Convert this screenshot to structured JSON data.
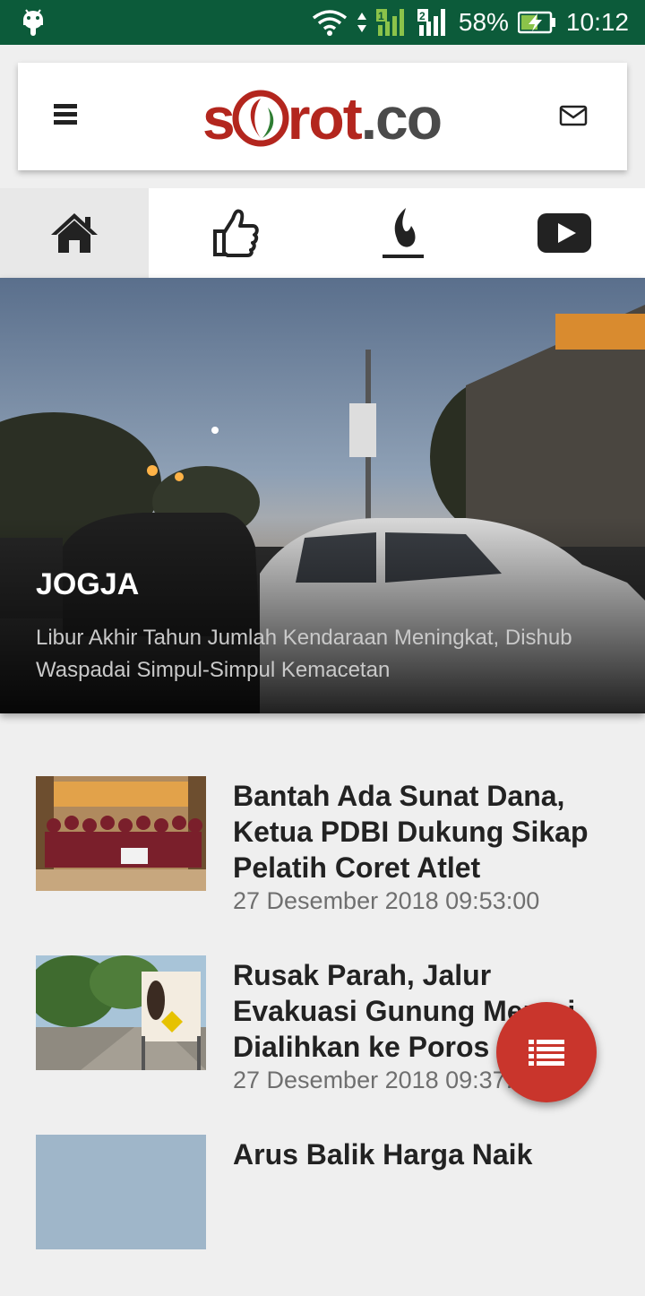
{
  "status_bar": {
    "battery": "58%",
    "time": "10:12",
    "sim1": "1",
    "sim2": "2"
  },
  "header": {
    "logo_left": "s",
    "logo_right": "rot",
    "logo_suffix": ".co"
  },
  "tabs": [
    {
      "name": "home",
      "icon": "home-icon"
    },
    {
      "name": "popular",
      "icon": "thumbs-up-icon"
    },
    {
      "name": "trending",
      "icon": "flame-icon"
    },
    {
      "name": "video",
      "icon": "play-icon"
    }
  ],
  "hero": {
    "category": "JOGJA",
    "title": "Libur Akhir Tahun Jumlah Kendaraan Meningkat, Dishub Waspadai Simpul-Simpul Kemacetan"
  },
  "news": [
    {
      "title": "Bantah Ada Sunat Dana, Ketua PDBI Dukung Sikap Pelatih Coret Atlet",
      "date": "27 Desember 2018 09:53:00"
    },
    {
      "title": "Rusak Parah, Jalur Evakuasi Gunung Merapi Dialihkan ke Poros Pakem",
      "date": "27 Desember 2018 09:37:00"
    },
    {
      "title": "Arus Balik Harga Naik",
      "date": ""
    }
  ],
  "colors": {
    "status_bar": "#0c5b3a",
    "brand_red": "#c9352c",
    "logo_green": "#2e7d32"
  }
}
